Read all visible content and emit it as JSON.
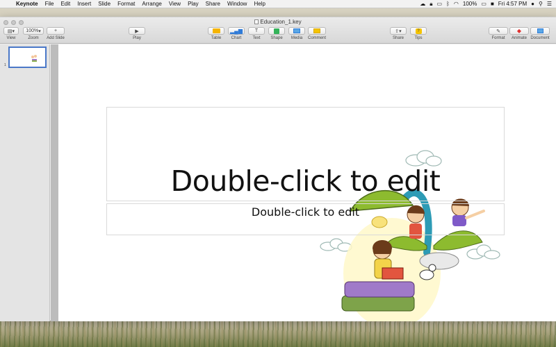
{
  "menubar": {
    "app_name": "Keynote",
    "items": [
      "File",
      "Edit",
      "Insert",
      "Slide",
      "Format",
      "Arrange",
      "View",
      "Play",
      "Share",
      "Window",
      "Help"
    ],
    "battery": "100%",
    "clock": "Fri 4:57 PM"
  },
  "window": {
    "title": "Education_1.key"
  },
  "toolbar": {
    "view_label": "View",
    "zoom_value": "100%",
    "zoom_label": "Zoom",
    "add_slide_label": "Add Slide",
    "play_label": "Play",
    "table_label": "Table",
    "chart_label": "Chart",
    "text_label": "Text",
    "shape_label": "Shape",
    "media_label": "Media",
    "comment_label": "Comment",
    "share_label": "Share",
    "tips_label": "Tips",
    "format_label": "Format",
    "animate_label": "Animate",
    "document_label": "Document",
    "accent_color": "#2f7bd8"
  },
  "sidebar": {
    "slides": [
      {
        "number": "1"
      }
    ]
  },
  "slide": {
    "title_placeholder": "Double-click to edit",
    "subtitle_placeholder": "Double-click to edit"
  }
}
